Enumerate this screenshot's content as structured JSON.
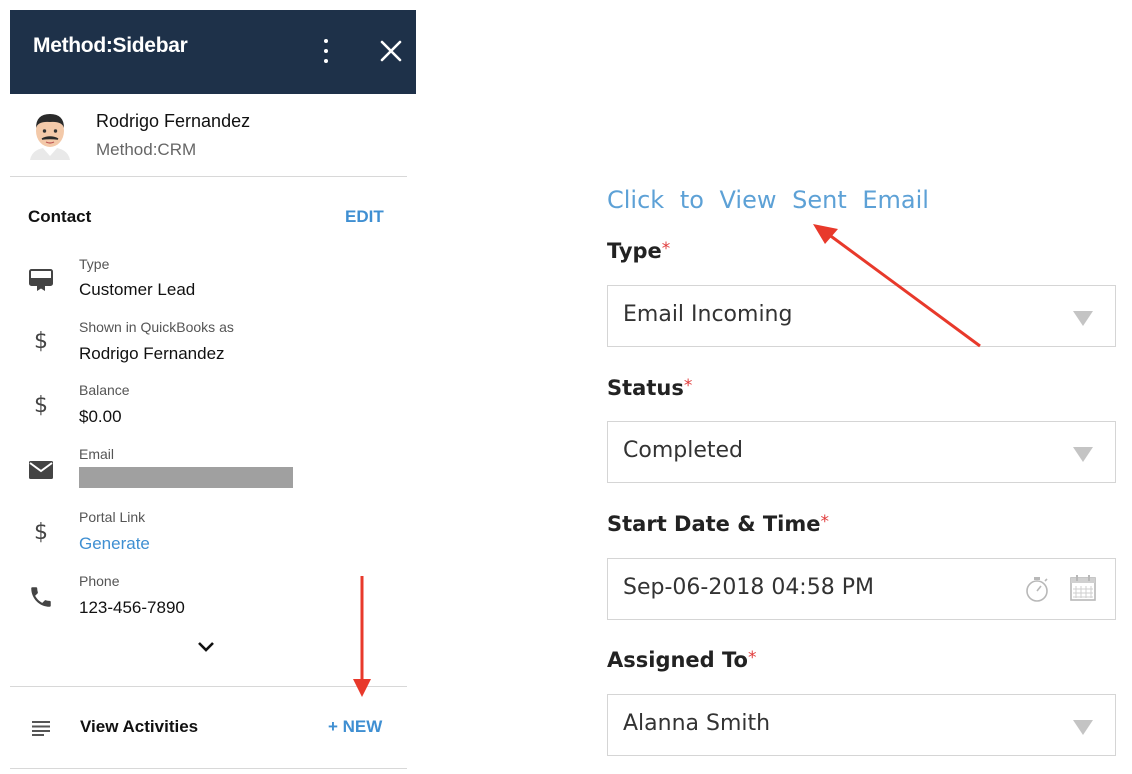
{
  "sidebar": {
    "title": "Method:Sidebar",
    "menu_icon": "kebab-menu-icon",
    "close_icon": "close-icon",
    "user": {
      "name": "Rodrigo Fernandez",
      "org": "Method:CRM",
      "avatar_icon": "man-face-avatar"
    },
    "contact": {
      "heading": "Contact",
      "edit_label": "EDIT",
      "fields": [
        {
          "icon": "id-card-icon",
          "label": "Type",
          "value": "Customer Lead"
        },
        {
          "icon": "dollar-icon",
          "label": "Shown in QuickBooks as",
          "value": "Rodrigo Fernandez"
        },
        {
          "icon": "dollar-icon",
          "label": "Balance",
          "value": "$0.00"
        },
        {
          "icon": "mail-icon",
          "label": "Email",
          "value": ""
        },
        {
          "icon": "dollar-icon",
          "label": "Portal Link",
          "value": "Generate"
        },
        {
          "icon": "phone-icon",
          "label": "Phone",
          "value": "123-456-7890"
        }
      ],
      "expand_icon": "chevron-down-icon"
    },
    "activities": {
      "icon": "list-icon",
      "label": "View Activities",
      "new_label": "+ NEW"
    }
  },
  "form": {
    "view_email_link": "Click to View Sent Email",
    "fields": [
      {
        "label": "Type",
        "required_mark": "*",
        "value": "Email Incoming",
        "control": "dropdown"
      },
      {
        "label": "Status",
        "required_mark": "*",
        "value": "Completed",
        "control": "dropdown"
      },
      {
        "label": "Start Date & Time",
        "required_mark": "*",
        "value": "Sep-06-2018 04:58 PM",
        "control": "datetime"
      },
      {
        "label": "Assigned To",
        "required_mark": "*",
        "value": "Alanna Smith",
        "control": "dropdown"
      }
    ]
  },
  "colors": {
    "header_bg": "#1e3149",
    "link_blue": "#3f8fd2",
    "form_link": "#5da1d6",
    "required_red": "#e03b3b",
    "annotation_arrow": "#e8392b"
  }
}
